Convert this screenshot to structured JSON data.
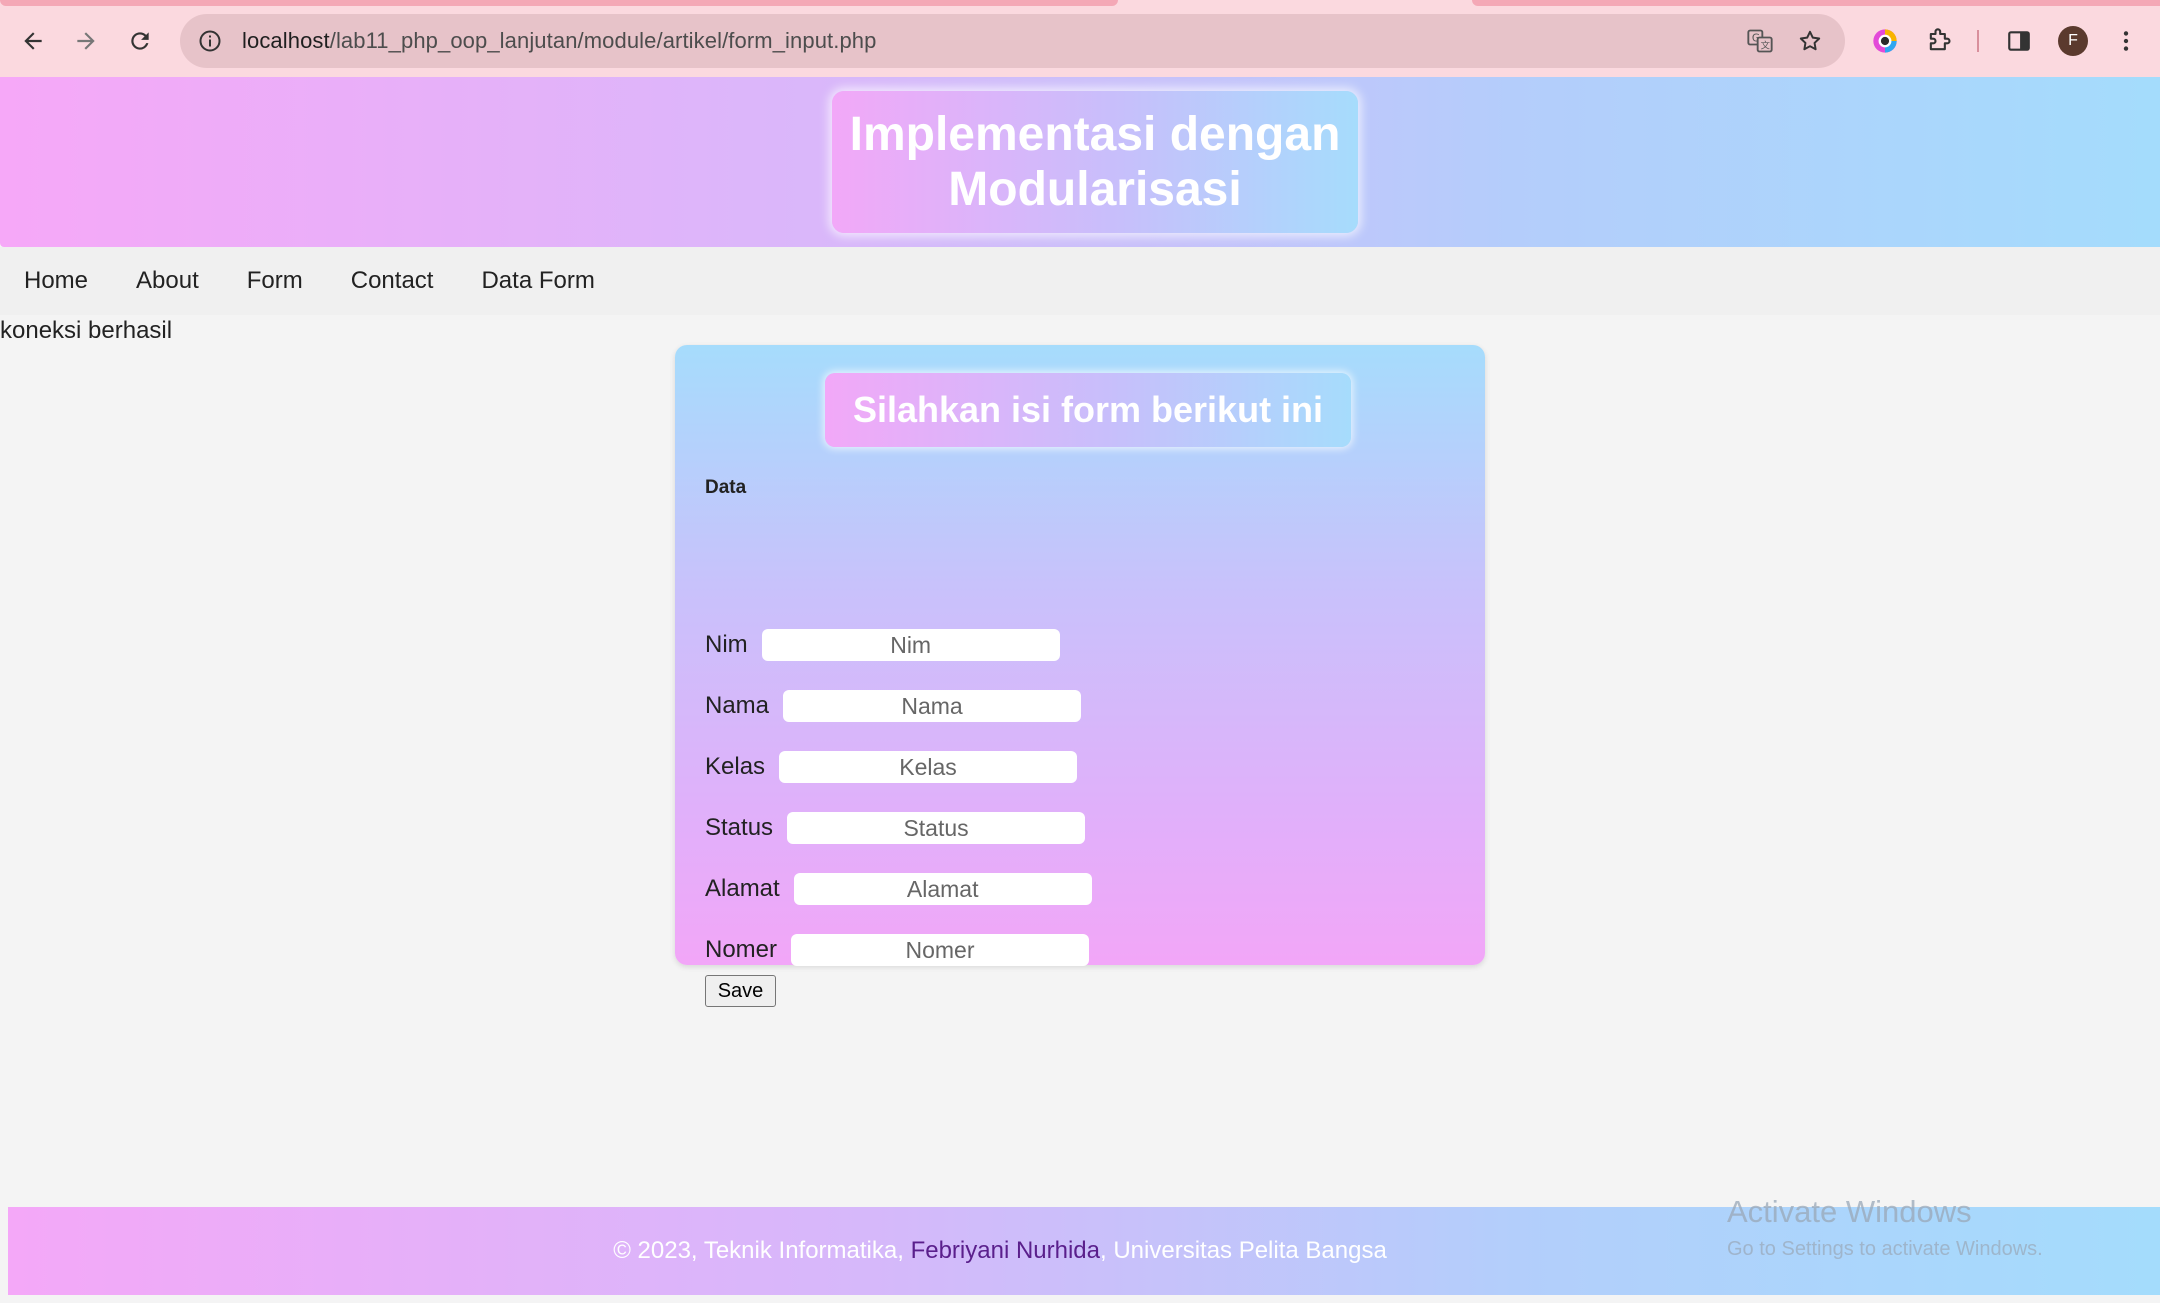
{
  "browser": {
    "url_host": "localhost",
    "url_path": "/lab11_php_oop_lanjutan/module/artikel/form_input.php",
    "profile_initial": "F",
    "icons": {
      "back": "back-arrow-icon",
      "forward": "forward-arrow-icon",
      "reload": "reload-icon",
      "site_info": "info-icon",
      "translate": "translate-icon",
      "bookmark": "star-icon",
      "extension_color": "color-extension-icon",
      "extensions": "puzzle-icon",
      "side_panel": "side-panel-icon",
      "menu": "kebab-menu-icon"
    }
  },
  "header": {
    "title_line1": "Implementasi dengan",
    "title_line2": "Modularisasi"
  },
  "nav": {
    "items": [
      "Home",
      "About",
      "Form",
      "Contact",
      "Data Form"
    ]
  },
  "status": "koneksi berhasil",
  "form": {
    "title": "Silahkan isi form berikut ini",
    "legend": "Data",
    "fields": [
      {
        "label": "Nim",
        "placeholder": "Nim"
      },
      {
        "label": "Nama",
        "placeholder": "Nama"
      },
      {
        "label": "Kelas",
        "placeholder": "Kelas"
      },
      {
        "label": "Status",
        "placeholder": "Status"
      },
      {
        "label": "Alamat",
        "placeholder": "Alamat"
      },
      {
        "label": "Nomer",
        "placeholder": "Nomer"
      }
    ],
    "save_label": "Save"
  },
  "footer": {
    "prefix": "© 2023, Teknik Informatika, ",
    "author": "Febriyani Nurhida",
    "suffix": ", Universitas Pelita Bangsa"
  },
  "watermark": {
    "line1": "Activate Windows",
    "line2": "Go to Settings to activate Windows."
  },
  "colors": {
    "gradient_pink": "#f6a8f8",
    "gradient_blue": "#a4dcfc",
    "footer_author": "#5a1f8c"
  }
}
